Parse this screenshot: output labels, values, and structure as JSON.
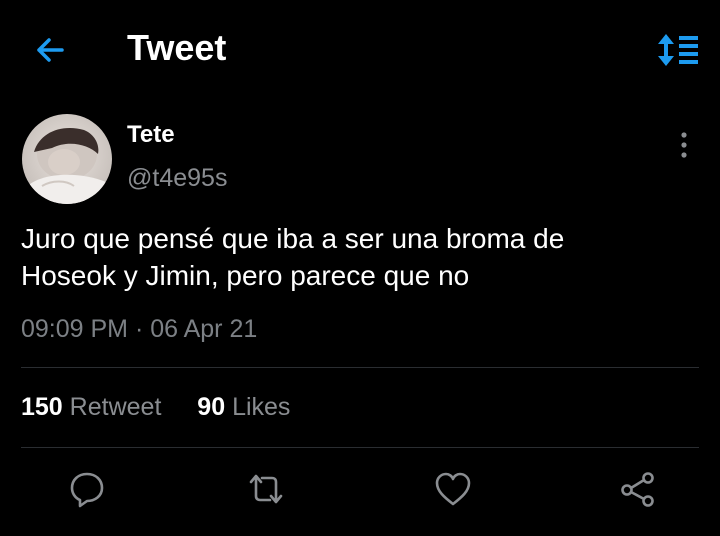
{
  "header": {
    "title": "Tweet"
  },
  "author": {
    "name": "Tete",
    "handle": "@t4e95s"
  },
  "tweet": {
    "text_lines": [
      "Juro que pensé que iba a ser una broma de",
      "Hoseok y Jimin, pero parece que no"
    ],
    "timestamp": "09:09 PM · 06 Apr 21"
  },
  "stats": {
    "retweets_count": "150",
    "retweets_label": "Retweet",
    "likes_count": "90",
    "likes_label": "Likes"
  },
  "colors": {
    "background": "#000000",
    "text": "#ffffff",
    "secondary_text": "#8a8d91",
    "accent": "#1d9bf0",
    "divider": "#2a2d31"
  },
  "icons": {
    "back": "arrow-left-icon",
    "sort": "sort-icon",
    "more": "more-vertical-icon",
    "reply": "reply-icon",
    "retweet": "retweet-icon",
    "like": "heart-icon",
    "share": "share-icon"
  }
}
